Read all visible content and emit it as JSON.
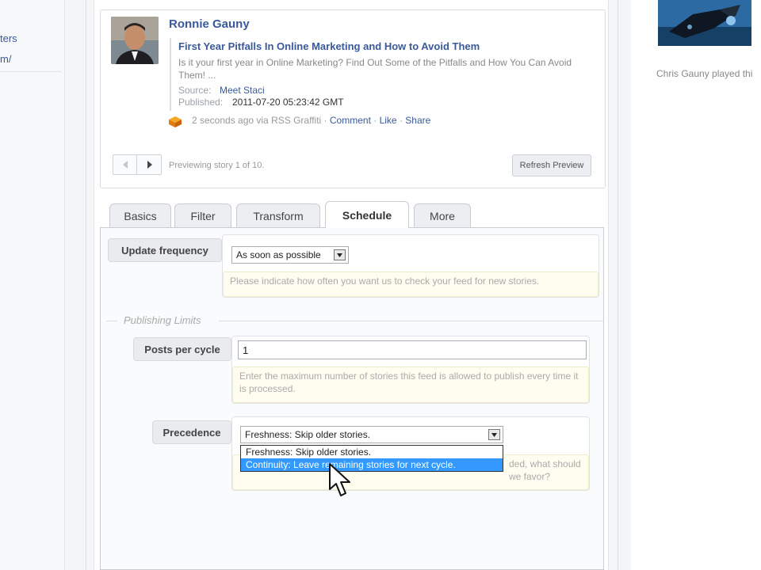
{
  "left_nav": {
    "items": [
      "ters",
      "m/"
    ]
  },
  "preview": {
    "author": "Ronnie Gauny",
    "story_title": "First Year Pitfalls In Online Marketing and How to Avoid Them",
    "description": "Is it your first year in Online Marketing? Find Out Some of the Pitfalls and How You Can Avoid Them! ...",
    "source_label": "Source:",
    "source_value": "Meet Staci",
    "published_label": "Published:",
    "published_value": "2011-07-20 05:23:42 GMT",
    "footer_time": "2 seconds ago via RSS Graffiti",
    "footer_sep": "·",
    "comment": "Comment",
    "like": "Like",
    "share": "Share",
    "pager_status": "Previewing story 1 of 10.",
    "refresh_label": "Refresh Preview"
  },
  "tabs": [
    {
      "label": "Basics",
      "active": false
    },
    {
      "label": "Filter",
      "active": false
    },
    {
      "label": "Transform",
      "active": false
    },
    {
      "label": "Schedule",
      "active": true
    },
    {
      "label": "More",
      "active": false
    }
  ],
  "schedule": {
    "update_frequency_label": "Update frequency",
    "update_frequency_value": "As soon as possible",
    "update_frequency_hint": "Please indicate how often you want us to check your feed for new stories.",
    "section_title": "Publishing Limits",
    "posts_per_cycle_label": "Posts per cycle",
    "posts_per_cycle_value": "1",
    "posts_per_cycle_hint": "Enter the maximum number of stories this feed is allowed to publish every time it is processed.",
    "precedence_label": "Precedence",
    "precedence_value": "Freshness: Skip older stories.",
    "precedence_options": [
      "Freshness: Skip older stories.",
      "Continuity: Leave remaining stories for next cycle."
    ],
    "precedence_hint_visible": "ded, what should we favor?"
  },
  "right_column": {
    "activity_text": "Chris Gauny played thi"
  },
  "colors": {
    "link": "#3b5998",
    "highlight": "#3399ff",
    "hint_bg": "#fffdf0"
  }
}
